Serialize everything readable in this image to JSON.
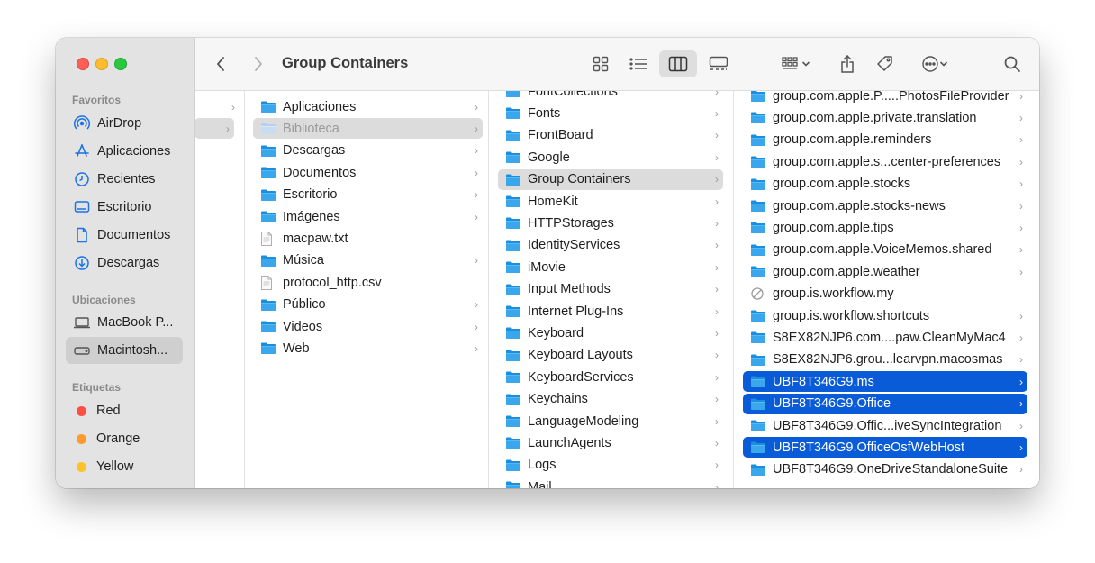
{
  "window": {
    "title": "Group Containers"
  },
  "sidebar": {
    "favorites_heading": "Favoritos",
    "favorites": [
      {
        "label": "AirDrop",
        "icon": "airdrop-icon"
      },
      {
        "label": "Aplicaciones",
        "icon": "applications-icon"
      },
      {
        "label": "Recientes",
        "icon": "clock-icon"
      },
      {
        "label": "Escritorio",
        "icon": "desktop-icon"
      },
      {
        "label": "Documentos",
        "icon": "document-icon"
      },
      {
        "label": "Descargas",
        "icon": "download-icon"
      }
    ],
    "locations_heading": "Ubicaciones",
    "locations": [
      {
        "label": "MacBook P...",
        "icon": "laptop-icon"
      },
      {
        "label": "Macintosh...",
        "icon": "disk-icon",
        "selected": true
      }
    ],
    "tags_heading": "Etiquetas",
    "tags": [
      {
        "label": "Red",
        "color": "#ff4f44"
      },
      {
        "label": "Orange",
        "color": "#ff9a2e"
      },
      {
        "label": "Yellow",
        "color": "#ffc229"
      }
    ]
  },
  "toolbar": {
    "back": "back-icon",
    "forward": "forward-icon",
    "views": [
      "icon-view-icon",
      "list-view-icon",
      "column-view-icon",
      "gallery-view-icon"
    ],
    "actions": [
      "group-icon",
      "share-icon",
      "tag-icon",
      "more-icon",
      "search-icon"
    ]
  },
  "columns": {
    "col2": [
      {
        "label": "Aplicaciones",
        "chev": true
      },
      {
        "label": "Biblioteca",
        "chev": true,
        "state": "gray-dim"
      },
      {
        "label": "Descargas",
        "chev": true
      },
      {
        "label": "Documentos",
        "chev": true
      },
      {
        "label": "Escritorio",
        "chev": true
      },
      {
        "label": "Imágenes",
        "chev": true
      },
      {
        "label": "macpaw.txt",
        "chev": false,
        "type": "file"
      },
      {
        "label": "Música",
        "chev": true
      },
      {
        "label": "protocol_http.csv",
        "chev": false,
        "type": "file"
      },
      {
        "label": "Público",
        "chev": true
      },
      {
        "label": "Videos",
        "chev": true
      },
      {
        "label": "Web",
        "chev": true
      }
    ],
    "col3": [
      {
        "label": "FontCollections",
        "chev": true
      },
      {
        "label": "Fonts",
        "chev": true
      },
      {
        "label": "FrontBoard",
        "chev": true
      },
      {
        "label": "Google",
        "chev": true
      },
      {
        "label": "Group Containers",
        "chev": true,
        "state": "gray"
      },
      {
        "label": "HomeKit",
        "chev": true
      },
      {
        "label": "HTTPStorages",
        "chev": true
      },
      {
        "label": "IdentityServices",
        "chev": true
      },
      {
        "label": "iMovie",
        "chev": true
      },
      {
        "label": "Input Methods",
        "chev": true
      },
      {
        "label": "Internet Plug-Ins",
        "chev": true
      },
      {
        "label": "Keyboard",
        "chev": true
      },
      {
        "label": "Keyboard Layouts",
        "chev": true
      },
      {
        "label": "KeyboardServices",
        "chev": true
      },
      {
        "label": "Keychains",
        "chev": true
      },
      {
        "label": "LanguageModeling",
        "chev": true
      },
      {
        "label": "LaunchAgents",
        "chev": true
      },
      {
        "label": "Logs",
        "chev": true
      },
      {
        "label": "Mail",
        "chev": true
      }
    ],
    "col4": [
      {
        "label": "group.com.apple.P.....PhotosFileProvider",
        "chev": true
      },
      {
        "label": "group.com.apple.private.translation",
        "chev": true
      },
      {
        "label": "group.com.apple.reminders",
        "chev": true
      },
      {
        "label": "group.com.apple.s...center-preferences",
        "chev": true
      },
      {
        "label": "group.com.apple.stocks",
        "chev": true
      },
      {
        "label": "group.com.apple.stocks-news",
        "chev": true
      },
      {
        "label": "group.com.apple.tips",
        "chev": true
      },
      {
        "label": "group.com.apple.VoiceMemos.shared",
        "chev": true
      },
      {
        "label": "group.com.apple.weather",
        "chev": true
      },
      {
        "label": "group.is.workflow.my",
        "chev": false,
        "type": "blocked"
      },
      {
        "label": "group.is.workflow.shortcuts",
        "chev": true
      },
      {
        "label": "S8EX82NJP6.com....paw.CleanMyMac4",
        "chev": true
      },
      {
        "label": "S8EX82NJP6.grou...learvpn.macosmas",
        "chev": true
      },
      {
        "label": "UBF8T346G9.ms",
        "chev": true,
        "state": "blue"
      },
      {
        "label": "UBF8T346G9.Office",
        "chev": true,
        "state": "blue"
      },
      {
        "label": "UBF8T346G9.Offic...iveSyncIntegration",
        "chev": true
      },
      {
        "label": "UBF8T346G9.OfficeOsfWebHost",
        "chev": true,
        "state": "blue"
      },
      {
        "label": "UBF8T346G9.OneDriveStandaloneSuite",
        "chev": true
      }
    ]
  }
}
